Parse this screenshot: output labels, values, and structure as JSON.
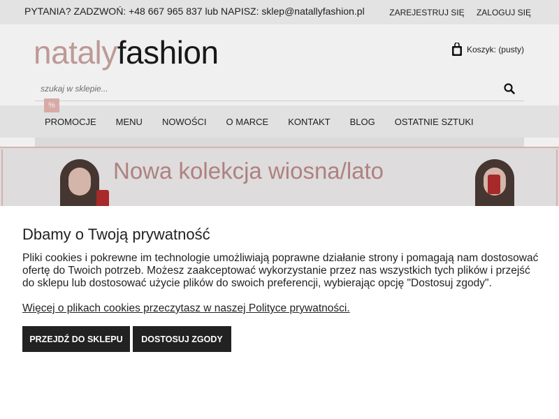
{
  "topbar": {
    "contact": "PYTANIA? ZADZWOŃ: +48 667 965 837 lub NAPISZ: sklep@natallyfashion.pl",
    "register": "ZAREJESTRUJ SIĘ",
    "login": "ZALOGUJ SIĘ"
  },
  "header": {
    "logo_part1": "nataly",
    "logo_part2": "fashion",
    "cart_label": "Koszyk: (pusty)",
    "cart_icon": "shopping-bag-icon",
    "search_placeholder": "szukaj w sklepie...",
    "search_icon": "search-icon"
  },
  "nav": {
    "promo_badge": "%",
    "items": [
      {
        "label": "PROMOCJE"
      },
      {
        "label": "MENU"
      },
      {
        "label": "NOWOŚCI"
      },
      {
        "label": "O MARCE"
      },
      {
        "label": "KONTAKT"
      },
      {
        "label": "BLOG"
      },
      {
        "label": "OSTATNIE SZTUKI"
      }
    ]
  },
  "banner": {
    "title": "Nowa kolekcja wiosna/lato"
  },
  "cookie": {
    "title": "Dbamy o Twoją prywatność",
    "text": "Pliki cookies i pokrewne im technologie umożliwiają poprawne działanie strony i pomagają nam dostosować ofertę do Twoich potrzeb. Możesz zaakceptować wykorzystanie przez nas wszystkich tych plików i przejść do sklepu lub dostosować użycie plików do swoich preferencji, wybierając opcję \"Dostosuj zgody\".",
    "link": "Więcej o plikach cookies przeczytasz w naszej Polityce prywatności.",
    "btn_shop": "PRZEJDŹ DO SKLEPU",
    "btn_customize": "DOSTOSUJ ZGODY"
  },
  "colors": {
    "accent_pink": "#c9a3a1",
    "badge_pink": "#e6b5b2",
    "button_dark": "#222222"
  }
}
